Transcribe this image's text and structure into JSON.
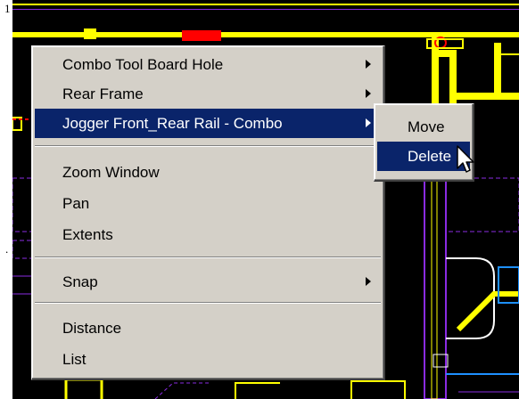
{
  "window": {
    "margin_marks": [
      "1",
      "."
    ]
  },
  "context_menu": {
    "items": [
      {
        "label": "Combo Tool Board Hole",
        "has_submenu": true
      },
      {
        "label": "Rear Frame",
        "has_submenu": true
      },
      {
        "label": "Jogger Front_Rear Rail - Combo",
        "has_submenu": true,
        "highlighted": true
      },
      {
        "label": "Zoom Window"
      },
      {
        "label": "Pan"
      },
      {
        "label": "Extents"
      },
      {
        "label": "Snap",
        "has_submenu": true
      },
      {
        "label": "Distance"
      },
      {
        "label": "List"
      }
    ]
  },
  "submenu": {
    "items": [
      {
        "label": "Move"
      },
      {
        "label": "Delete",
        "highlighted": true
      }
    ]
  },
  "colors": {
    "menu_bg": "#d4d0c8",
    "highlight": "#0a246a",
    "cad_background": "#000000",
    "cad_yellow": "#ffff00",
    "cad_purple": "#8a2be2",
    "cad_red": "#ff0000"
  }
}
